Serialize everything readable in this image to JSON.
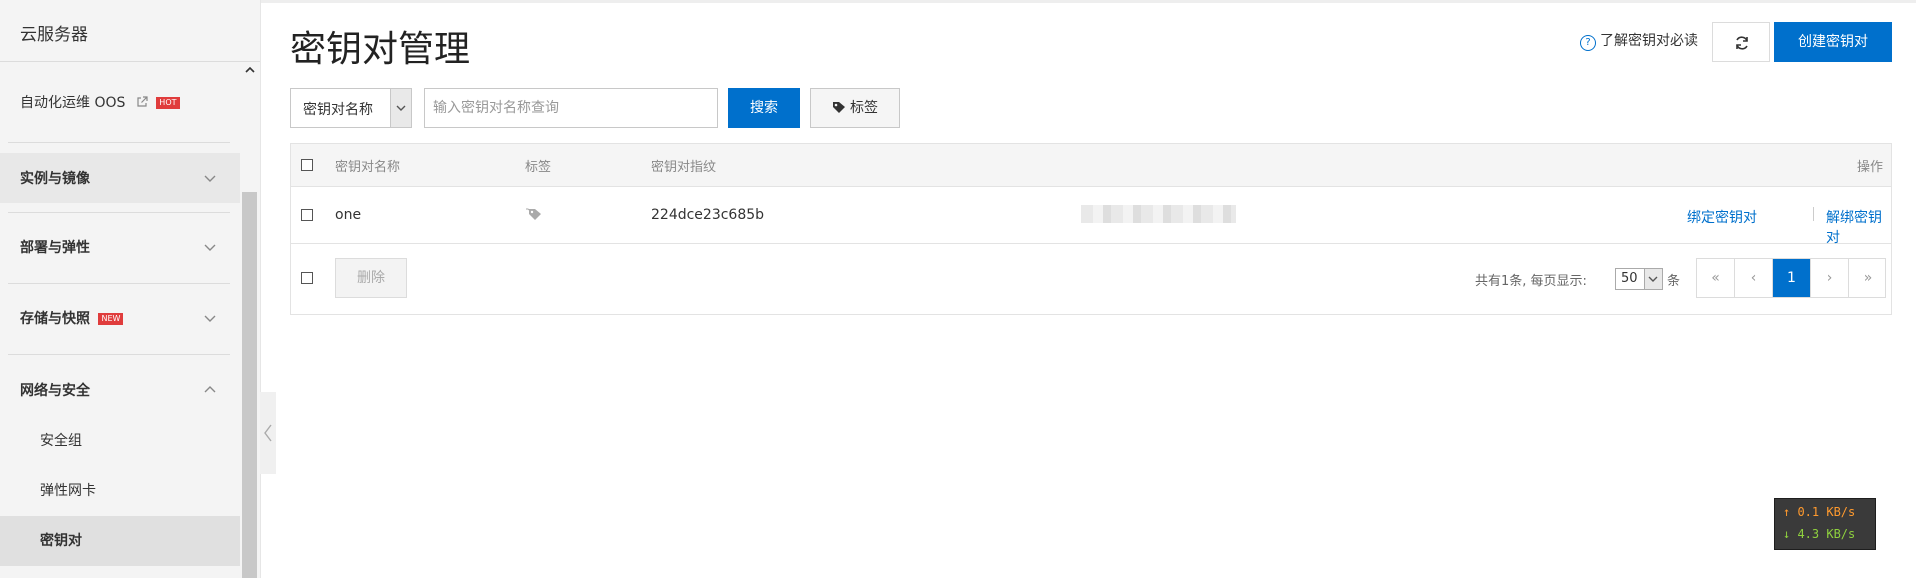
{
  "colors": {
    "accent": "#0070cc",
    "brand": "#ff6a00",
    "hot_badge": "#e03c3c"
  },
  "sidebar": {
    "title": "云服务器",
    "items": [
      {
        "label": "自动化运维 OOS",
        "badge": "HOT",
        "icon": "external-link-icon"
      },
      {
        "label": "实例与镜像",
        "icon": "chevron-down-icon"
      },
      {
        "label": "部署与弹性",
        "icon": "chevron-down-icon"
      },
      {
        "label": "存储与快照",
        "badge": "NEW",
        "icon": "chevron-down-icon"
      },
      {
        "label": "网络与安全",
        "icon": "chevron-up-icon"
      }
    ],
    "sub_items": [
      {
        "label": "安全组"
      },
      {
        "label": "弹性网卡"
      },
      {
        "label": "密钥对"
      }
    ]
  },
  "header": {
    "title": "密钥对管理",
    "help_link": "了解密钥对必读",
    "create_button": "创建密钥对"
  },
  "toolbar": {
    "filter_select": "密钥对名称",
    "search_placeholder": "输入密钥对名称查询",
    "search_button": "搜索",
    "tag_button": "标签"
  },
  "table": {
    "columns": [
      "密钥对名称",
      "标签",
      "密钥对指纹",
      "操作"
    ],
    "rows": [
      {
        "name": "one",
        "fingerprint": "224dce23c685b",
        "actions": [
          "绑定密钥对",
          "解绑密钥对"
        ]
      }
    ],
    "delete_button": "删除",
    "pagination": {
      "summary": "共有1条, 每页显示:",
      "page_size": "50",
      "unit": "条",
      "first": "«",
      "prev": "‹",
      "current": "1",
      "next": "›",
      "last": "»"
    }
  },
  "network_widget": {
    "upload": "↑ 0.1 KB/s",
    "download": "↓ 4.3 KB/s"
  }
}
